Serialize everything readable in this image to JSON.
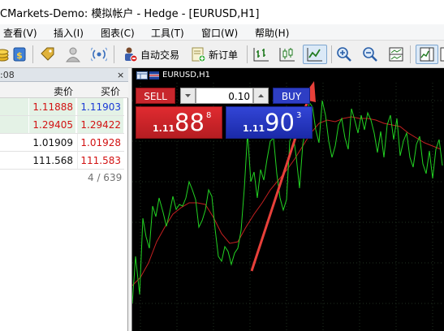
{
  "window": {
    "title": "CMarkets-Demo: 模拟帐户 - Hedge - [EURUSD,H1]"
  },
  "menu": [
    "查看(V)",
    "插入(I)",
    "图表(C)",
    "工具(T)",
    "窗口(W)",
    "帮助(H)"
  ],
  "toolbar": {
    "auto_trading_label": "自动交易",
    "new_order_label": "新订单"
  },
  "market_watch": {
    "time": ":08",
    "close_glyph": "×",
    "columns": {
      "bid": "卖价",
      "ask": "买价"
    },
    "rows": [
      {
        "bid": "1.11888",
        "ask": "1.11903",
        "bid_dir": "down",
        "ask_dir": "up",
        "tinted": true
      },
      {
        "bid": "1.29405",
        "ask": "1.29422",
        "bid_dir": "down",
        "ask_dir": "down",
        "tinted": true
      },
      {
        "bid": "1.01909",
        "ask": "1.01928",
        "bid_dir": "flat",
        "ask_dir": "down",
        "tinted": false
      },
      {
        "bid": "111.568",
        "ask": "111.583",
        "bid_dir": "flat",
        "ask_dir": "down",
        "tinted": false
      }
    ],
    "count": "4 / 639"
  },
  "chart": {
    "tab_symbol": "EURUSD,H1",
    "colors": {
      "background": "#000000",
      "price_line": "#22d322",
      "moving_average": "#c42020",
      "annotation_arrow": "#e8403a"
    }
  },
  "trade_panel": {
    "sell_label": "SELL",
    "buy_label": "BUY",
    "volume": "0.10",
    "sell": {
      "prefix": "1.11",
      "big": "88",
      "sup": "8"
    },
    "buy": {
      "prefix": "1.11",
      "big": "90",
      "sup": "3"
    }
  },
  "colors": {
    "sell": "#c8262c",
    "buy": "#2e3ec4",
    "bid_up": "#1a39d6",
    "bid_down": "#d21212"
  },
  "icons": [
    "gold-coins-icon",
    "market-watch-icon",
    "tag-icon",
    "user-icon",
    "signal-icon",
    "auto-trading-icon",
    "new-order-icon",
    "bar-chart-icon",
    "candlestick-icon",
    "line-chart-icon",
    "zoom-in-icon",
    "zoom-out-icon",
    "tile-windows-icon",
    "chart-shift-icon",
    "autoscroll-icon"
  ]
}
